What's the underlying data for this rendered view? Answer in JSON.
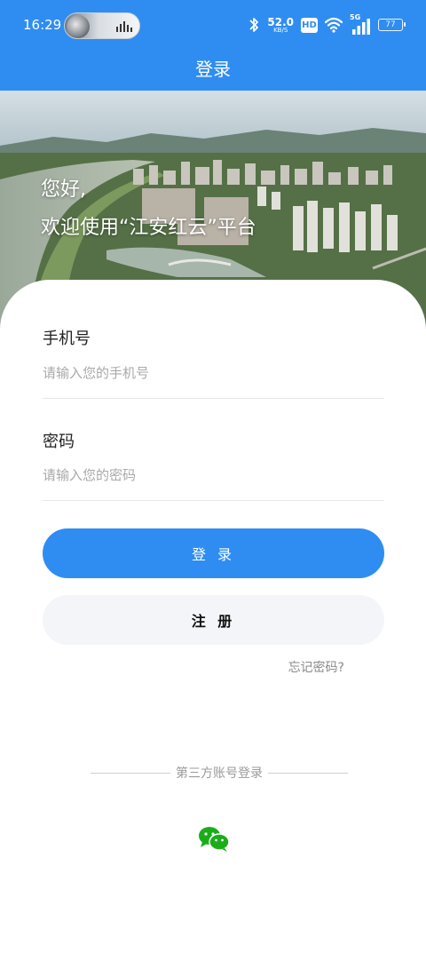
{
  "status_bar": {
    "time": "16:29",
    "net_speed_value": "52.0",
    "net_speed_unit": "KB/S",
    "hd_label": "HD",
    "signal_type": "5G",
    "battery_level": "77",
    "icons": [
      "music-pill",
      "bluetooth-icon",
      "wifi-icon",
      "signal-icon",
      "battery-icon"
    ]
  },
  "nav": {
    "title": "登录"
  },
  "hero": {
    "greeting": "您好,",
    "welcome": "欢迎使用“江安红云”平台"
  },
  "form": {
    "phone_label": "手机号",
    "phone_placeholder": "请输入您的手机号",
    "phone_value": "",
    "password_label": "密码",
    "password_placeholder": "请输入您的密码",
    "password_value": "",
    "login_button": "登 录",
    "register_button": "注 册",
    "forgot_password": "忘记密码?"
  },
  "third_party": {
    "divider_text": "第三方账号登录",
    "providers": [
      {
        "icon": "wechat-icon"
      }
    ]
  },
  "colors": {
    "brand_blue": "#2f8df1",
    "register_bg": "#f4f5f8",
    "placeholder": "#a9a9a9",
    "wechat_green": "#1aad19"
  }
}
